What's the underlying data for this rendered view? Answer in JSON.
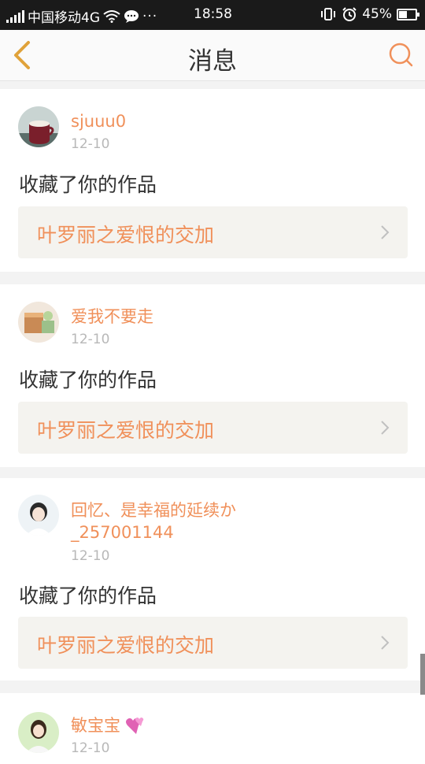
{
  "status_bar": {
    "carrier": "中国移动4G",
    "time": "18:58",
    "battery": "45%"
  },
  "header": {
    "title": "消息"
  },
  "messages": [
    {
      "username": "sjuuu0",
      "date": "12-10",
      "action": "收藏了你的作品",
      "work_title": "叶罗丽之爱恨的交加"
    },
    {
      "username": "爱我不要走",
      "date": "12-10",
      "action": "收藏了你的作品",
      "work_title": "叶罗丽之爱恨的交加"
    },
    {
      "username_line1": "回忆、是幸福的延续か",
      "username_line2": "_257001144",
      "date": "12-10",
      "action": "收藏了你的作品",
      "work_title": "叶罗丽之爱恨的交加"
    },
    {
      "username": "敏宝宝",
      "date": "12-10"
    }
  ],
  "colors": {
    "accent": "#f0905a",
    "status_bar": "#1a1a1a",
    "work_bg": "#f4f3ef"
  }
}
